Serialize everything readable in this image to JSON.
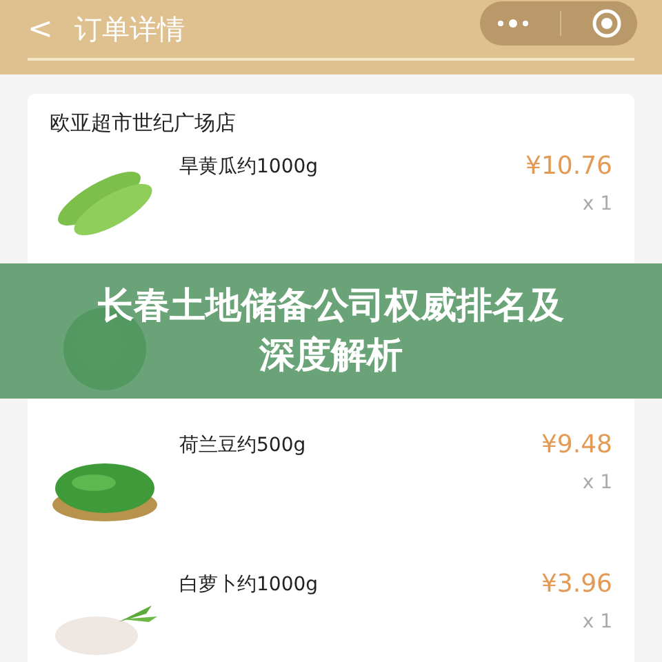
{
  "header": {
    "back": "<",
    "title": "订单详情"
  },
  "store": {
    "name": "欧亚超市世纪广场店"
  },
  "items": [
    {
      "kind": "cucumber",
      "name": "旱黄瓜约1000g",
      "price": "¥10.76",
      "quantity": "x 1"
    },
    {
      "kind": "cabbage"
    },
    {
      "kind": "peas",
      "name": "荷兰豆约500g",
      "price": "¥9.48",
      "quantity": "x 1"
    },
    {
      "kind": "radish",
      "name": "白萝卜约1000g",
      "price": "¥3.96",
      "quantity": "x 1"
    }
  ],
  "banner": {
    "title": "长春土地储备公司权威排名及深度解析"
  }
}
